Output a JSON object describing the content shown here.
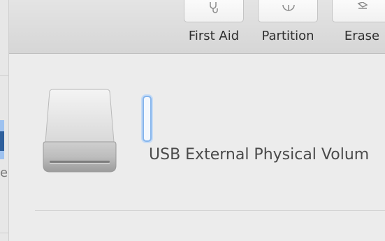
{
  "toolbar": {
    "first_aid": {
      "label": "First Aid",
      "icon": "stethoscope-icon"
    },
    "partition": {
      "label": "Partition",
      "icon": "pie-chart-icon"
    },
    "erase": {
      "label": "Erase",
      "icon": "eraser-icon"
    }
  },
  "sidebar": {
    "fragment_text": "e"
  },
  "volume": {
    "name_field_value": "",
    "description": "USB External Physical Volum"
  },
  "colors": {
    "selection": "#9ec2f0",
    "focus_ring": "#86b5ec"
  }
}
